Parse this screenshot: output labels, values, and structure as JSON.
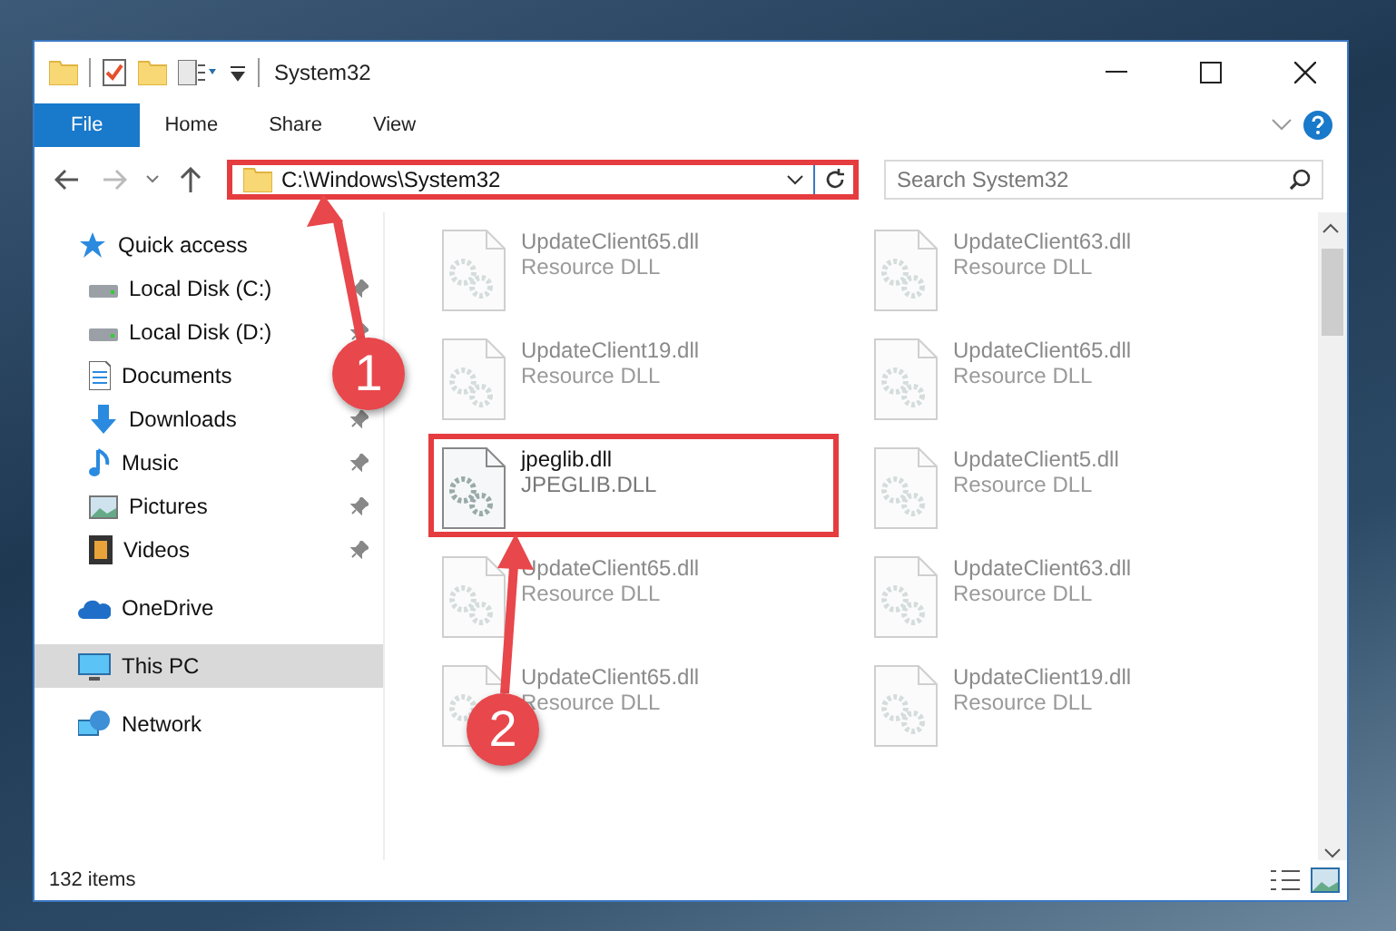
{
  "window": {
    "title": "System32"
  },
  "ribbon_tabs": [
    {
      "label": "File",
      "kind": "file"
    },
    {
      "label": "Home",
      "kind": "tab"
    },
    {
      "label": "Share",
      "kind": "tab"
    },
    {
      "label": "View",
      "kind": "tab"
    }
  ],
  "address_bar": {
    "path": "C:\\Windows\\System32",
    "highlighted": true
  },
  "search": {
    "placeholder": "Search System32"
  },
  "sidebar": {
    "items": [
      {
        "label": "Quick access",
        "kind": "star",
        "selected": false,
        "children": [
          {
            "label": "Local Disk (C:)",
            "kind": "disk",
            "selected": false,
            "pinned": true
          },
          {
            "label": "Local Disk (D:)",
            "kind": "disk",
            "selected": false,
            "pinned": true
          },
          {
            "label": "Documents",
            "kind": "documents",
            "selected": false
          },
          {
            "label": "Downloads",
            "kind": "downloads",
            "selected": false,
            "pinned": true
          },
          {
            "label": "Music",
            "kind": "music",
            "selected": false,
            "pinned": true
          },
          {
            "label": "Pictures",
            "kind": "pictures",
            "selected": false,
            "pinned": true
          },
          {
            "label": "Videos",
            "kind": "videos",
            "selected": false,
            "pinned": true
          }
        ]
      },
      {
        "label": "OneDrive",
        "kind": "cloud",
        "selected": false
      },
      {
        "label": "This PC",
        "kind": "pc",
        "selected": true
      },
      {
        "label": "Network",
        "kind": "network",
        "selected": false
      }
    ]
  },
  "files": [
    {
      "name": "UpdateClient65.dll",
      "type": "Resource DLL",
      "highlighted": false,
      "blurred": true
    },
    {
      "name": "UpdateClient63.dll",
      "type": "Resource DLL",
      "highlighted": false,
      "blurred": true
    },
    {
      "name": "UpdateClient19.dll",
      "type": "Resource DLL",
      "highlighted": false,
      "blurred": true
    },
    {
      "name": "UpdateClient65.dll",
      "type": "Resource DLL",
      "highlighted": false,
      "blurred": true
    },
    {
      "name": "jpeglib.dll",
      "type": "JPEGLIB.DLL",
      "highlighted": true,
      "blurred": false
    },
    {
      "name": "UpdateClient5.dll",
      "type": "Resource DLL",
      "highlighted": false,
      "blurred": true
    },
    {
      "name": "UpdateClient65.dll",
      "type": "Resource DLL",
      "highlighted": false,
      "blurred": true
    },
    {
      "name": "UpdateClient63.dll",
      "type": "Resource DLL",
      "highlighted": false,
      "blurred": true
    },
    {
      "name": "UpdateClient65.dll",
      "type": "Resource DLL",
      "highlighted": false,
      "blurred": true
    },
    {
      "name": "UpdateClient19.dll",
      "type": "Resource DLL",
      "highlighted": false,
      "blurred": true
    }
  ],
  "status_bar": {
    "count": "132 items"
  },
  "annotations": [
    {
      "number": "1"
    },
    {
      "number": "2"
    }
  ]
}
